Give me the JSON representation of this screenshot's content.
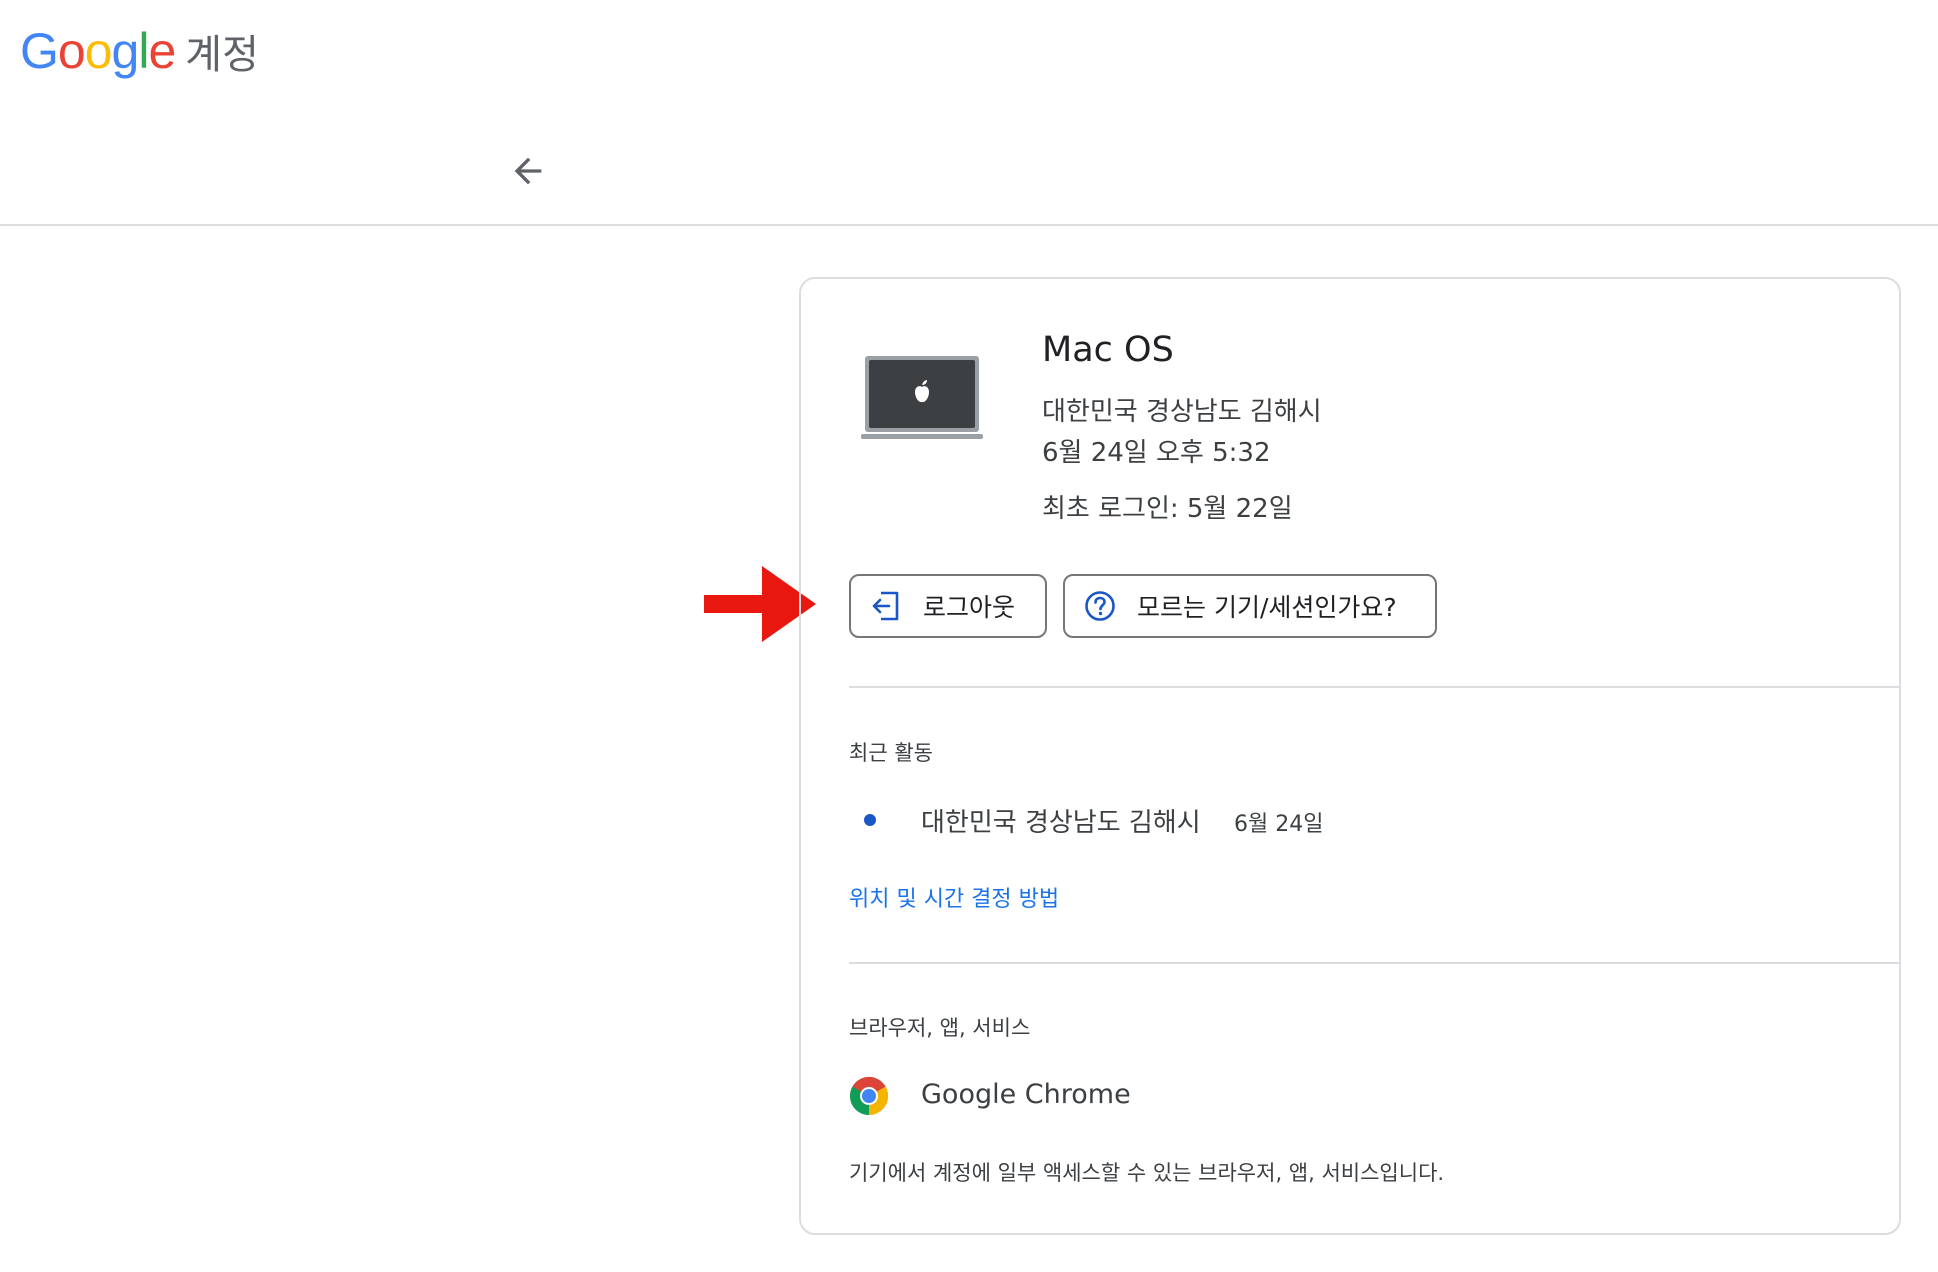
{
  "header": {
    "logo_text": "Google",
    "logo_letters": [
      {
        "char": "G",
        "color": "#4285F4"
      },
      {
        "char": "o",
        "color": "#EA4335"
      },
      {
        "char": "o",
        "color": "#FBBC05"
      },
      {
        "char": "g",
        "color": "#4285F4"
      },
      {
        "char": "l",
        "color": "#34A853"
      },
      {
        "char": "e",
        "color": "#EA4335"
      }
    ],
    "product_name": "계정",
    "back_icon": "arrow-left-icon"
  },
  "device": {
    "name": "Mac OS",
    "image_icon": "macbook-icon",
    "location": "대한민국 경상남도 김해시",
    "last_active": "6월 24일 오후 5:32",
    "first_signin": "최초 로그인: 5월 22일"
  },
  "actions": {
    "logout_label": "로그아웃",
    "logout_icon": "logout-icon",
    "unknown_label": "모르는 기기/세션인가요?",
    "unknown_icon": "help-circle-icon"
  },
  "recent_activity": {
    "label": "최근 활동",
    "items": [
      {
        "location": "대한민국 경상남도 김해시",
        "date": "6월 24일"
      }
    ],
    "help_link": "위치 및 시간 결정 방법"
  },
  "browsers": {
    "label": "브라우저, 앱, 서비스",
    "items": [
      {
        "name": "Google Chrome",
        "icon": "chrome-icon"
      }
    ],
    "description": "기기에서 계정에 일부 액세스할 수 있는 브라우저, 앱, 서비스입니다."
  },
  "colors": {
    "link": "#1a73e8",
    "border": "#dadce0",
    "annotation": "#e8170f",
    "dot": "#1a56c8"
  }
}
